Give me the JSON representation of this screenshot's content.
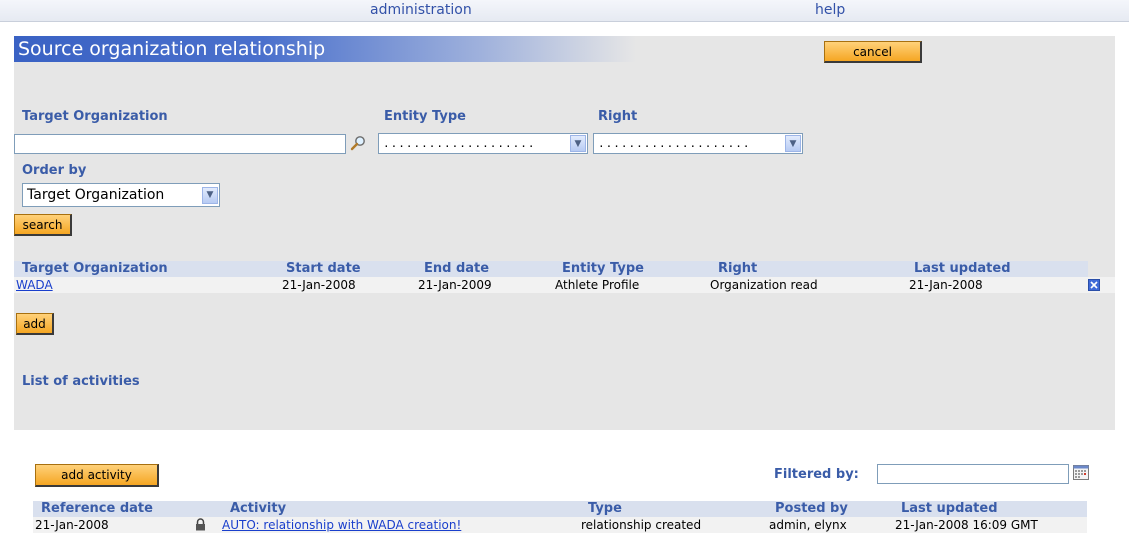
{
  "nav": {
    "administration": "administration",
    "help": "help"
  },
  "page_title": "Source organization relationship",
  "buttons": {
    "cancel": "cancel",
    "search": "search",
    "add": "add",
    "add_activity": "add activity"
  },
  "filters": {
    "target_org_label": "Target Organization",
    "target_org_value": "",
    "entity_type_label": "Entity Type",
    "entity_type_value": "....................",
    "right_label": "Right",
    "right_value": "....................",
    "order_by_label": "Order by",
    "order_by_value": "Target Organization"
  },
  "relationships_table": {
    "columns": [
      "Target Organization",
      "Start date",
      "End date",
      "Entity Type",
      "Right",
      "Last updated"
    ],
    "rows": [
      {
        "target_org": "WADA",
        "start": "21-Jan-2008",
        "end": "21-Jan-2009",
        "entity_type": "Athlete Profile",
        "right": "Organization read",
        "updated": "21-Jan-2008"
      }
    ]
  },
  "activities": {
    "heading": "List of activities",
    "filtered_by_label": "Filtered by:",
    "filtered_by_value": "",
    "columns": [
      "Reference date",
      "Activity",
      "Type",
      "Posted by",
      "Last updated"
    ],
    "rows": [
      {
        "date": "21-Jan-2008",
        "activity": "AUTO: relationship with WADA creation!",
        "type": "relationship created",
        "posted_by": "admin, elynx",
        "updated": "21-Jan-2008 16:09 GMT"
      }
    ]
  },
  "icons": [
    "magnifier-icon",
    "dropdown-arrow-icon",
    "delete-icon",
    "calendar-icon",
    "lock-icon"
  ],
  "colors": {
    "accent": "#3a62c4",
    "button": "#f5a623",
    "label": "#3a5ca8",
    "link": "#1a3fcc"
  }
}
